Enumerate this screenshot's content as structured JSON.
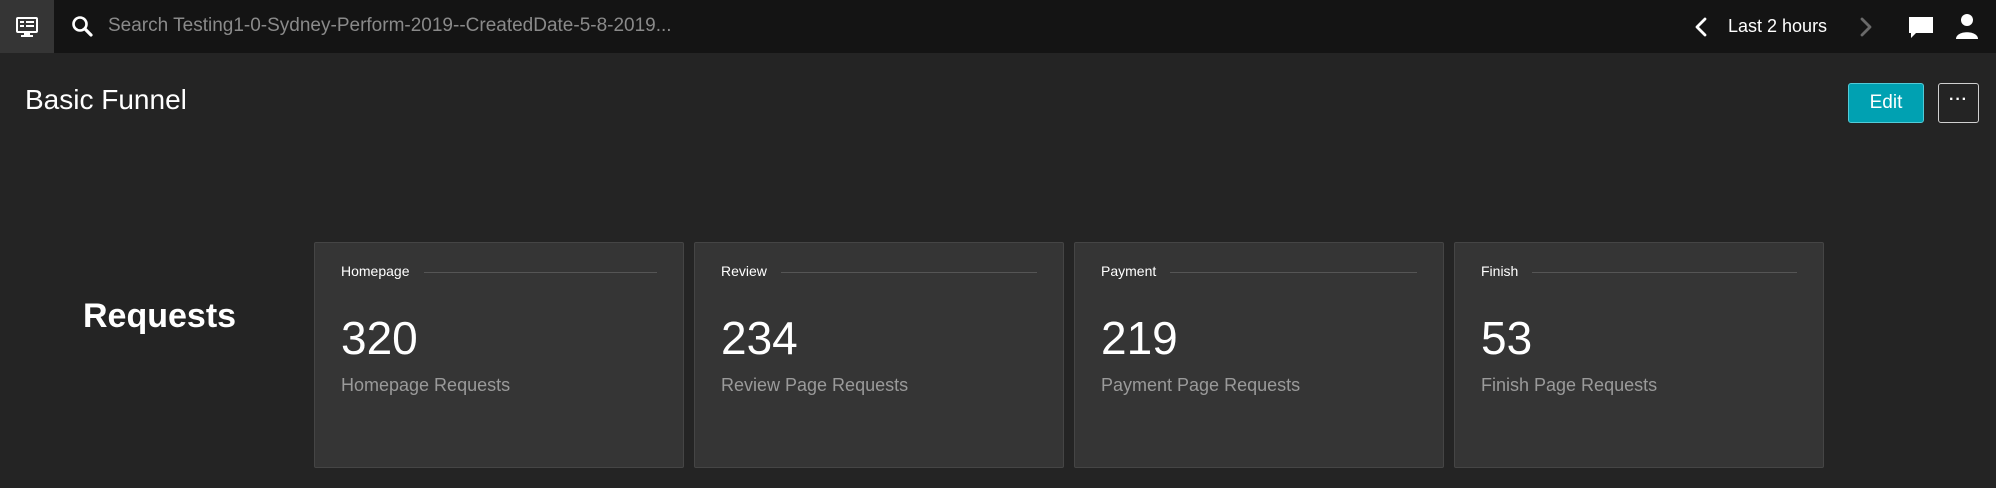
{
  "topbar": {
    "menu_icon": "monitor-menu-icon",
    "search_icon": "search-icon",
    "search_placeholder": "Search Testing1-0-Sydney-Perform-2019--CreatedDate-5-8-2019...",
    "timeframe_label": "Last 2 hours",
    "prev_icon": "chevron-left-icon",
    "next_icon": "chevron-right-icon",
    "chat_icon": "chat-icon",
    "user_icon": "user-icon"
  },
  "header": {
    "title": "Basic Funnel",
    "edit_label": "Edit",
    "more_label": "···"
  },
  "row": {
    "label": "Requests"
  },
  "tiles": [
    {
      "title": "Homepage",
      "value": "320",
      "caption": "Homepage Requests"
    },
    {
      "title": "Review",
      "value": "234",
      "caption": "Review Page Requests"
    },
    {
      "title": "Payment",
      "value": "219",
      "caption": "Payment Page Requests"
    },
    {
      "title": "Finish",
      "value": "53",
      "caption": "Finish Page Requests"
    }
  ],
  "colors": {
    "background": "#242424",
    "topbar": "#141414",
    "tile": "#353535",
    "accent": "#00a1b2"
  }
}
